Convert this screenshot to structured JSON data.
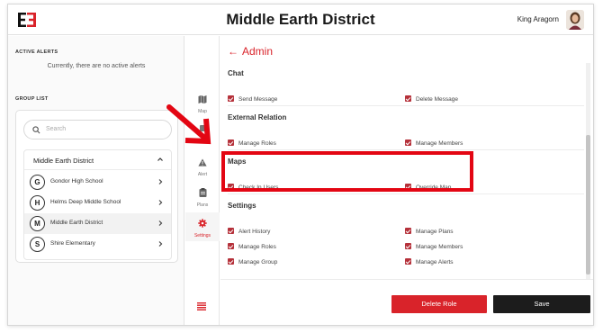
{
  "header": {
    "logo_text": "E3",
    "title": "Middle Earth District",
    "user_name": "King Aragorn"
  },
  "left_panel": {
    "active_alerts_label": "ACTIVE ALERTS",
    "alerts_message": "Currently, there are no active alerts",
    "group_list_label": "GROUP LIST",
    "search_placeholder": "Search",
    "district": {
      "name": "Middle Earth District",
      "expanded": true
    },
    "schools": [
      {
        "initial": "G",
        "name": "Gondor High School",
        "selected": false
      },
      {
        "initial": "H",
        "name": "Helms Deep Middle School",
        "selected": false
      },
      {
        "initial": "M",
        "name": "Middle Earth District",
        "selected": true
      },
      {
        "initial": "S",
        "name": "Shire Elementary",
        "selected": false
      }
    ]
  },
  "nav_rail": {
    "items": [
      {
        "label": "Map",
        "icon": "map-icon",
        "active": false
      },
      {
        "label": "Alert",
        "icon": "warning-icon",
        "active": false
      },
      {
        "label": "Plans",
        "icon": "clipboard-icon",
        "active": false
      },
      {
        "label": "Settings",
        "icon": "gear-icon",
        "active": true
      }
    ],
    "bottom_icon": "menu-icon"
  },
  "main": {
    "back_label": "Admin",
    "sections": [
      {
        "title": "Chat",
        "items": [
          {
            "label": "Send Message",
            "checked": true
          },
          {
            "label": "Delete Message",
            "checked": true
          }
        ]
      },
      {
        "title": "External Relation",
        "items": [
          {
            "label": "Manage Roles",
            "checked": true
          },
          {
            "label": "Manage Members",
            "checked": true
          }
        ]
      },
      {
        "title": "Maps",
        "items": [
          {
            "label": "Check In Users",
            "checked": true
          },
          {
            "label": "Override Map",
            "checked": true
          }
        ]
      },
      {
        "title": "Settings",
        "items": [
          {
            "label": "Alert History",
            "checked": true
          },
          {
            "label": "Manage Plans",
            "checked": true
          },
          {
            "label": "Manage Roles",
            "checked": true
          },
          {
            "label": "Manage Members",
            "checked": true
          },
          {
            "label": "Manage Group",
            "checked": true
          },
          {
            "label": "Manage Alerts",
            "checked": true
          }
        ]
      }
    ],
    "delete_role_label": "Delete Role",
    "save_label": "Save"
  },
  "colors": {
    "accent": "#d9232a",
    "checkbox": "#b5313a",
    "annotation": "#e30613",
    "save_button": "#1c1c1c"
  }
}
